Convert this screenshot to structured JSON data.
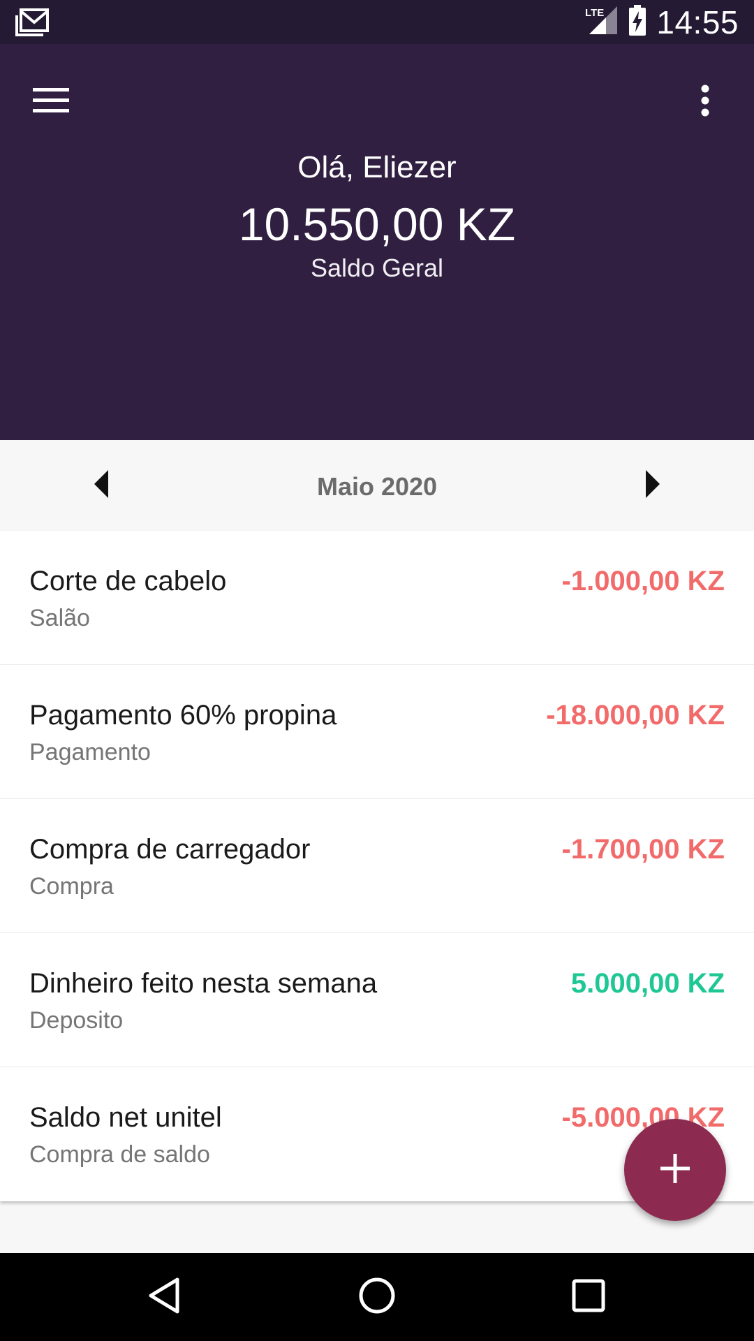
{
  "status_bar": {
    "time": "14:55",
    "network": "LTE",
    "icons": [
      "gmail-icon",
      "lte-signal-icon",
      "battery-charging-icon"
    ]
  },
  "header": {
    "greeting": "Olá, Eliezer",
    "balance": "10.550,00 KZ",
    "balance_label": "Saldo Geral",
    "icons": [
      "menu-icon",
      "more-vert-icon"
    ]
  },
  "month_selector": {
    "label": "Maio 2020",
    "icons": [
      "prev-arrow-icon",
      "next-arrow-icon"
    ]
  },
  "transactions": [
    {
      "title": "Corte de cabelo",
      "category": "Salão",
      "amount": "-1.000,00 KZ",
      "type": "expense"
    },
    {
      "title": "Pagamento 60% propina",
      "category": "Pagamento",
      "amount": "-18.000,00 KZ",
      "type": "expense"
    },
    {
      "title": "Compra de carregador",
      "category": "Compra",
      "amount": "-1.700,00 KZ",
      "type": "expense"
    },
    {
      "title": "Dinheiro feito nesta semana",
      "category": "Deposito",
      "amount": "5.000,00 KZ",
      "type": "income"
    },
    {
      "title": "Saldo net unitel",
      "category": "Compra de saldo",
      "amount": "-5.000,00 KZ",
      "type": "expense"
    }
  ],
  "fab": {
    "icon": "add-icon"
  },
  "nav_bar": {
    "icons": [
      "back-icon",
      "home-icon",
      "recents-icon"
    ]
  },
  "colors": {
    "header_bg": "#301f40",
    "status_bg": "#241a33",
    "expense": "#f26b6b",
    "income": "#1ec793",
    "fab": "#8c2a50"
  }
}
